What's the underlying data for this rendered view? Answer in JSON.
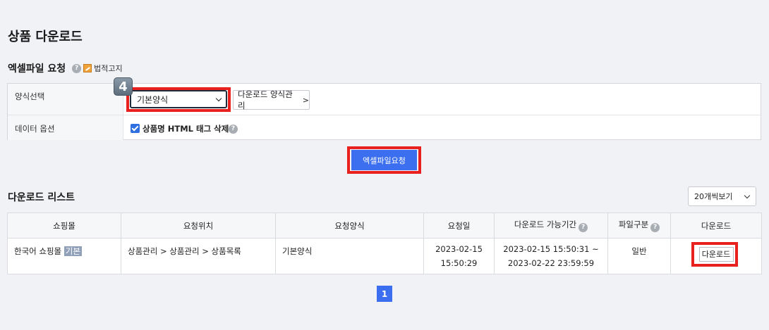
{
  "page_title": "상품 다운로드",
  "excel_request": {
    "title": "엑셀파일 요청",
    "help_glyph": "?",
    "legal_label": "법적고지",
    "callout_number": "4",
    "form_label": "양식선택",
    "form_selected": "기본양식",
    "manage_button": "다운로드 양식관리",
    "manage_arrow": ">",
    "data_option_label": "데이터 옵션",
    "checkbox_label": "상품명 HTML 태그 삭제",
    "checkbox_checked": true,
    "submit_button": "엑셀파일요청"
  },
  "download_list": {
    "title": "다운로드 리스트",
    "page_size": "20개씩보기",
    "columns": [
      "쇼핑몰",
      "요청위치",
      "요청양식",
      "요청일",
      "다운로드 가능기간",
      "파일구분",
      "다운로드"
    ],
    "rows": [
      {
        "mall": "한국어 쇼핑몰",
        "mall_tag": "기본",
        "location": "상품관리 > 상품관리 > 상품목록",
        "format": "기본양식",
        "request_date": "2023-02-15",
        "request_time": "15:50:29",
        "period_start": "2023-02-15 15:50:31 ~",
        "period_end": "2023-02-22 23:59:59",
        "file_type": "일반",
        "download_button": "다운로드"
      }
    ],
    "current_page": "1"
  },
  "colors": {
    "primary": "#3b6ff0",
    "highlight_frame": "#e8211f",
    "background": "#f1f2f5"
  }
}
